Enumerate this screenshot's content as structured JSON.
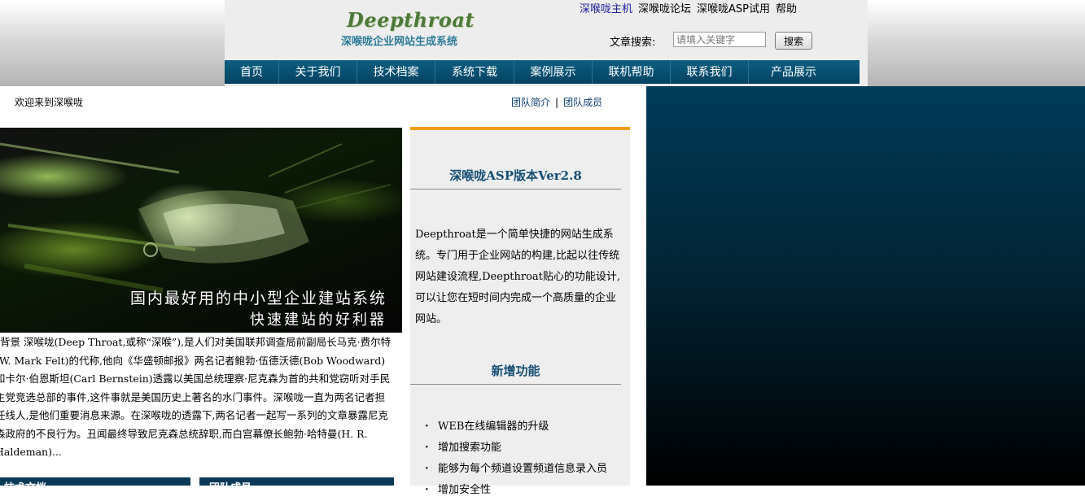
{
  "header": {
    "logo": "Deepthroat",
    "logo_sub": "深喉咙企业网站生成系统",
    "top_links": [
      "深喉咙主机",
      "深喉咙论坛",
      "深喉咙ASP试用",
      "帮助"
    ],
    "search": {
      "label": "文章搜索:",
      "placeholder": "请填入关键字",
      "button": "搜索"
    }
  },
  "nav": [
    "首页",
    "关于我们",
    "技术档案",
    "系统下载",
    "案例展示",
    "联机帮助",
    "联系我们",
    "产品展示"
  ],
  "welcome": "欢迎来到深喉咙",
  "team_links": [
    "团队简介",
    "团队成员"
  ],
  "team_sep": "|",
  "banner": {
    "line1": "国内最好用的中小型企业建站系统",
    "line2": "快速建站的好利器"
  },
  "article": "背景 深喉咙(Deep Throat,或称“深喉”),是人们对美国联邦调查局前副局长马克·费尔特(W. Mark Felt)的代称,他向《华盛顿邮报》两名记者鲍勃·伍德沃德(Bob Woodward)和卡尔·伯恩斯坦(Carl Bernstein)透露以美国总统理察·尼克森为首的共和党窃听对手民主党竞选总部的事件,这件事就是美国历史上著名的水门事件。深喉咙一直为两名记者担任线人,是他们重要消息来源。在深喉咙的透露下,两名记者一起写一系列的文章暴露尼克森政府的不良行为。丑闻最终导致尼克森总统辞职,而白宫幕僚长鲍勃·哈特曼(H. R. Haldeman)...",
  "sections": {
    "tech": "技术文档",
    "team": "团队成员"
  },
  "sidebar": {
    "title1": "深喉咙ASP版本Ver2.8",
    "desc": "Deepthroat是一个简单快捷的网站生成系统。专门用于企业网站的构建,比起以往传统网站建设流程,Deepthroat贴心的功能设计,可以让您在短时间内完成一个高质量的企业网站。",
    "title2": "新增功能",
    "features": [
      "WEB在线编辑器的升级",
      "增加搜索功能",
      "能够为每个频道设置频道信息录入员",
      "增加安全性"
    ]
  },
  "colors": {
    "nav": "#0d5e82",
    "accent": "#f19b1c",
    "title": "#144e74",
    "panel": "#003b59"
  }
}
